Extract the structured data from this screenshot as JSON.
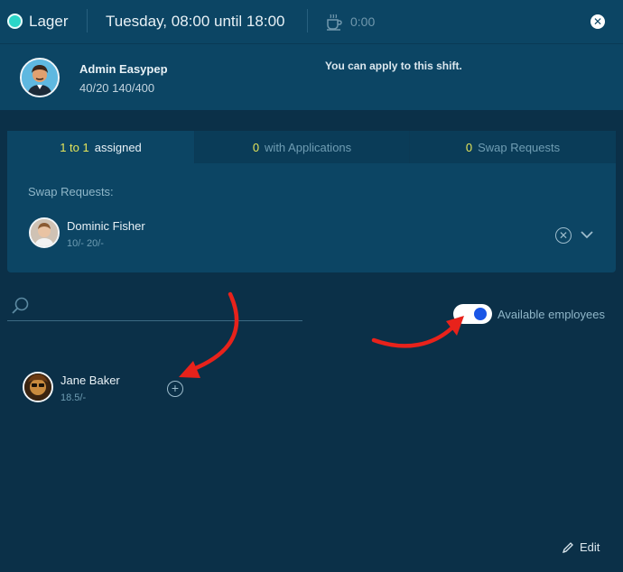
{
  "topbar": {
    "location": "Lager",
    "shift_time": "Tuesday, 08:00 until 18:00",
    "break_time": "0:00",
    "location_color": "#2bd6c8"
  },
  "header": {
    "user_name": "Admin Easypep",
    "user_hours": "40/20 140/400",
    "apply_message": "You can apply to this shift."
  },
  "tabs": [
    {
      "count": "1 to 1",
      "label": "assigned"
    },
    {
      "count": "0",
      "label": "with Applications"
    },
    {
      "count": "0",
      "label": "Swap Requests"
    }
  ],
  "swap": {
    "title": "Swap Requests:",
    "employee_name": "Dominic Fisher",
    "employee_hours": "10/- 20/-"
  },
  "search": {
    "placeholder": ""
  },
  "toggle": {
    "label": "Available employees",
    "on": true
  },
  "employees": [
    {
      "name": "Jane Baker",
      "hours": "18.5/-"
    }
  ],
  "footer": {
    "edit_label": "Edit"
  },
  "colors": {
    "background": "#0b3048",
    "panel": "#0c4564",
    "accent_yellow": "#e6e65a",
    "toggle_knob": "#1a56e6",
    "annotation_arrow": "#e8221b"
  },
  "icons": [
    "location-dot-icon",
    "coffee-cup-icon",
    "close-icon",
    "search-icon",
    "remove-icon",
    "chevron-down-icon",
    "add-icon",
    "pencil-icon"
  ]
}
